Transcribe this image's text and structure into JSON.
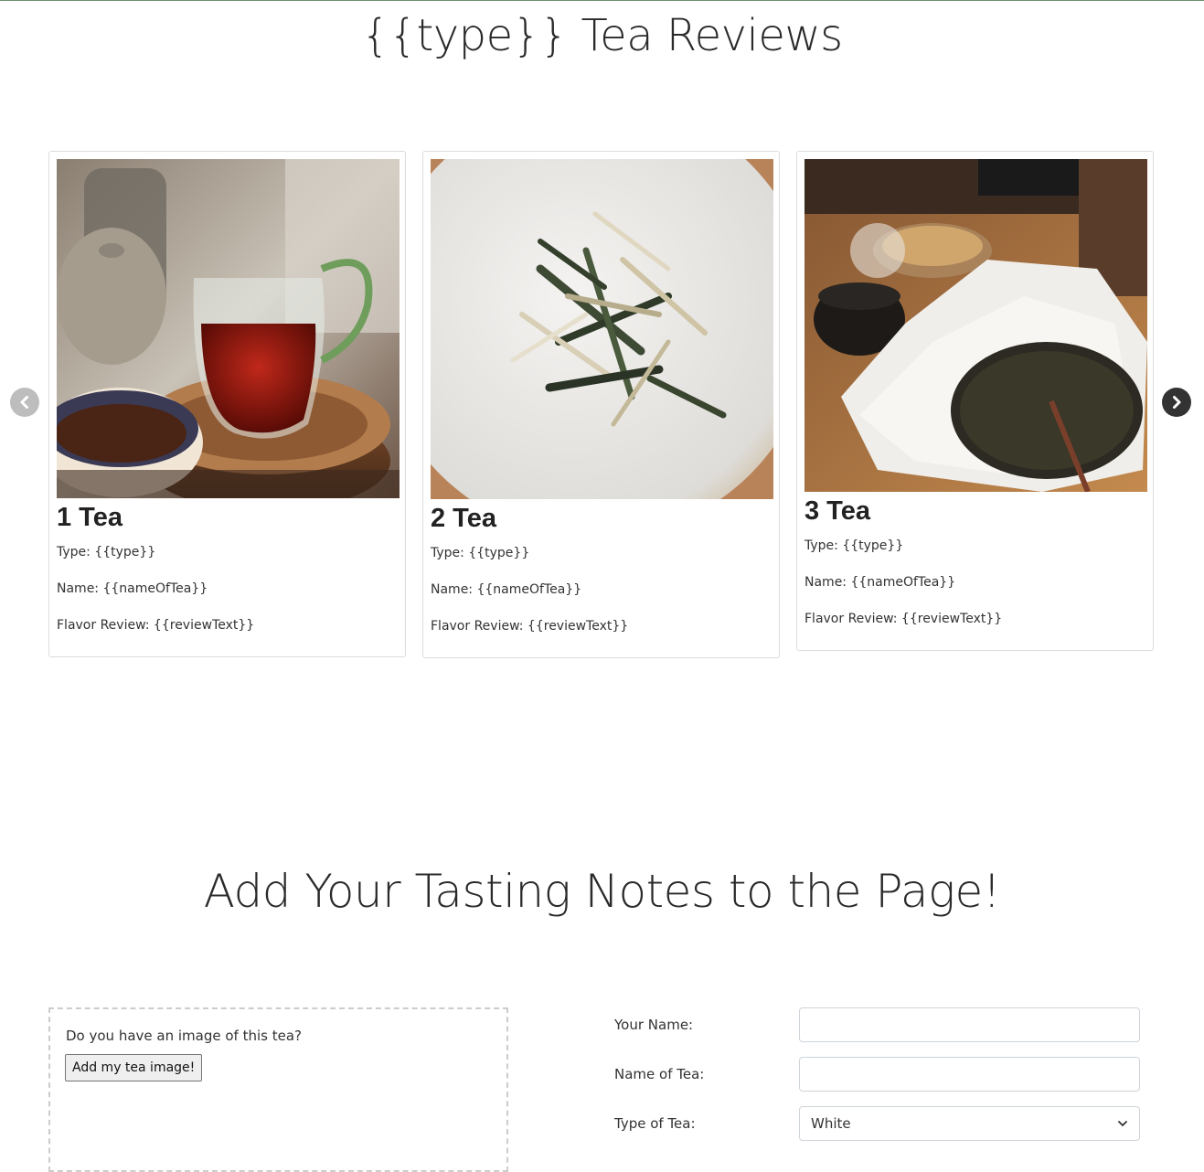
{
  "page": {
    "title": "{{type}} Tea Reviews"
  },
  "carousel": {
    "cards": [
      {
        "title": "1 Tea",
        "type_line": "Type: {{type}}",
        "name_line": "Name: {{nameOfTea}}",
        "review_line": "Flavor Review: {{reviewText}}"
      },
      {
        "title": "2 Tea",
        "type_line": "Type: {{type}}",
        "name_line": "Name: {{nameOfTea}}",
        "review_line": "Flavor Review: {{reviewText}}"
      },
      {
        "title": "3 Tea",
        "type_line": "Type: {{type}}",
        "name_line": "Name: {{nameOfTea}}",
        "review_line": "Flavor Review: {{reviewText}}"
      }
    ],
    "prev_icon": "chevron-left-icon",
    "next_icon": "chevron-right-icon"
  },
  "add_section": {
    "title": "Add Your Tasting Notes to the Page!",
    "image_prompt": "Do you have an image of this tea?",
    "image_button": "Add my tea image!",
    "form": {
      "your_name_label": "Your Name:",
      "your_name_value": "",
      "tea_name_label": "Name of Tea:",
      "tea_name_value": "",
      "tea_type_label": "Type of Tea:",
      "tea_type_selected": "White"
    }
  }
}
